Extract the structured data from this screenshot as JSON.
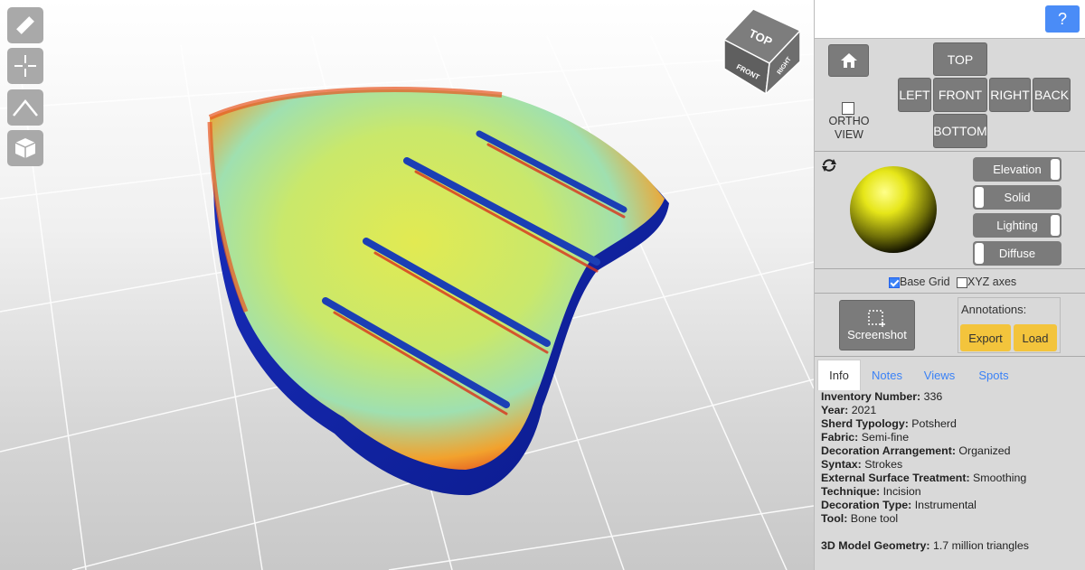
{
  "toolbar": {
    "tools": [
      {
        "name": "measure-tool-button",
        "icon": "ruler-icon"
      },
      {
        "name": "pick-point-button",
        "icon": "crosshair-icon"
      },
      {
        "name": "angle-tool-button",
        "icon": "angle-icon"
      },
      {
        "name": "section-tool-button",
        "icon": "cube-icon"
      }
    ]
  },
  "navcube": {
    "top": "TOP",
    "front": "FRONT",
    "right": "RIGHT"
  },
  "panel": {
    "help_label": "?",
    "views": {
      "home_icon": "home-icon",
      "top": "TOP",
      "left": "LEFT",
      "front": "FRONT",
      "right": "RIGHT",
      "back": "BACK",
      "bottom": "BOTTOM",
      "ortho_line1": "ORTHO",
      "ortho_line2": "VIEW",
      "ortho_checked": false
    },
    "render": {
      "reset_icon": "rotate-icon",
      "sphere_color": "#e6e619",
      "toggles": [
        {
          "label": "Elevation",
          "on": true
        },
        {
          "label": "Solid",
          "on": false
        },
        {
          "label": "Lighting",
          "on": true
        },
        {
          "label": "Diffuse",
          "on": false
        }
      ]
    },
    "grid": {
      "base_grid_label": "Base Grid",
      "base_grid_checked": true,
      "xyz_label": "XYZ axes",
      "xyz_checked": false
    },
    "screenshot_label": "Screenshot",
    "annotations": {
      "title": "Annotations:",
      "export_label": "Export",
      "load_label": "Load"
    },
    "tabs": [
      "Info",
      "Notes",
      "Views",
      "Spots"
    ],
    "active_tab": "Info",
    "info": [
      {
        "key": "Inventory Number:",
        "value": " 336"
      },
      {
        "key": "Year:",
        "value": " 2021"
      },
      {
        "key": "Sherd Typology:",
        "value": " Potsherd"
      },
      {
        "key": "Fabric:",
        "value": " Semi-fine"
      },
      {
        "key": "Decoration Arrangement:",
        "value": " Organized"
      },
      {
        "key": "Syntax:",
        "value": " Strokes"
      },
      {
        "key": "External Surface Treatment:",
        "value": " Smoothing"
      },
      {
        "key": "Technique:",
        "value": " Incision"
      },
      {
        "key": "Decoration Type:",
        "value": " Instrumental"
      },
      {
        "key": "Tool:",
        "value": " Bone tool"
      }
    ],
    "geometry": {
      "key": "3D Model Geometry:",
      "value": " 1.7 million triangles"
    }
  },
  "colors": {
    "accent": "#4a8cf7",
    "button_gray": "#7b7b7b",
    "annotation_yellow": "#f3c43c"
  }
}
